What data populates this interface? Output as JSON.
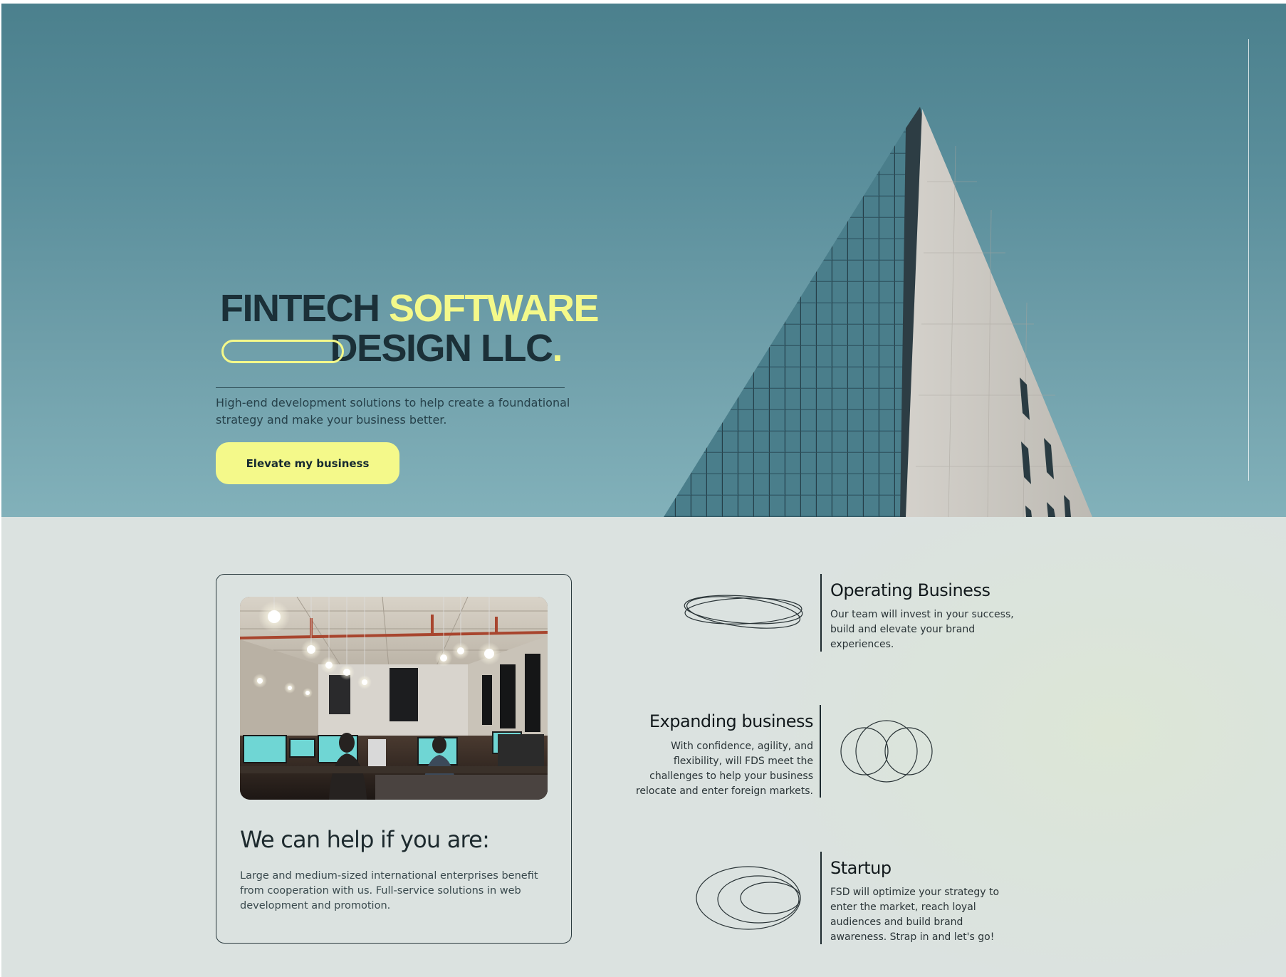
{
  "hero": {
    "title_part1": "FINTECH ",
    "title_accent": "SOFTWARE",
    "title_part2": "DESIGN LLC",
    "title_dot": ".",
    "subtitle": "High-end development solutions to help create a foundational strategy and make your business better.",
    "cta_label": "Elevate my business"
  },
  "help": {
    "heading": "We can help if you are:",
    "text": "Large and medium-sized international enterprises benefit from cooperation with us. Full-service solutions in web development and promotion."
  },
  "features": [
    {
      "title": "Operating Business",
      "text": "Our team will invest in your success, build and elevate your brand experiences.",
      "icon": "interlocking-ellipses-icon"
    },
    {
      "title": "Expanding business",
      "text": "With confidence, agility, and flexibility, will FDS meet the challenges to help your business relocate and enter foreign markets.",
      "icon": "overlapping-circles-icon"
    },
    {
      "title": "Startup",
      "text": "FSD will optimize your strategy to enter the market, reach loyal audiences and build brand awareness. Strap in and let's go!",
      "icon": "nested-ellipses-icon"
    }
  ],
  "colors": {
    "accent_yellow": "#f4f98a",
    "dark_text": "#1b3038",
    "hero_top": "#4b808d",
    "hero_bottom": "#82b1ba",
    "section_bg": "#dbe2e1"
  }
}
